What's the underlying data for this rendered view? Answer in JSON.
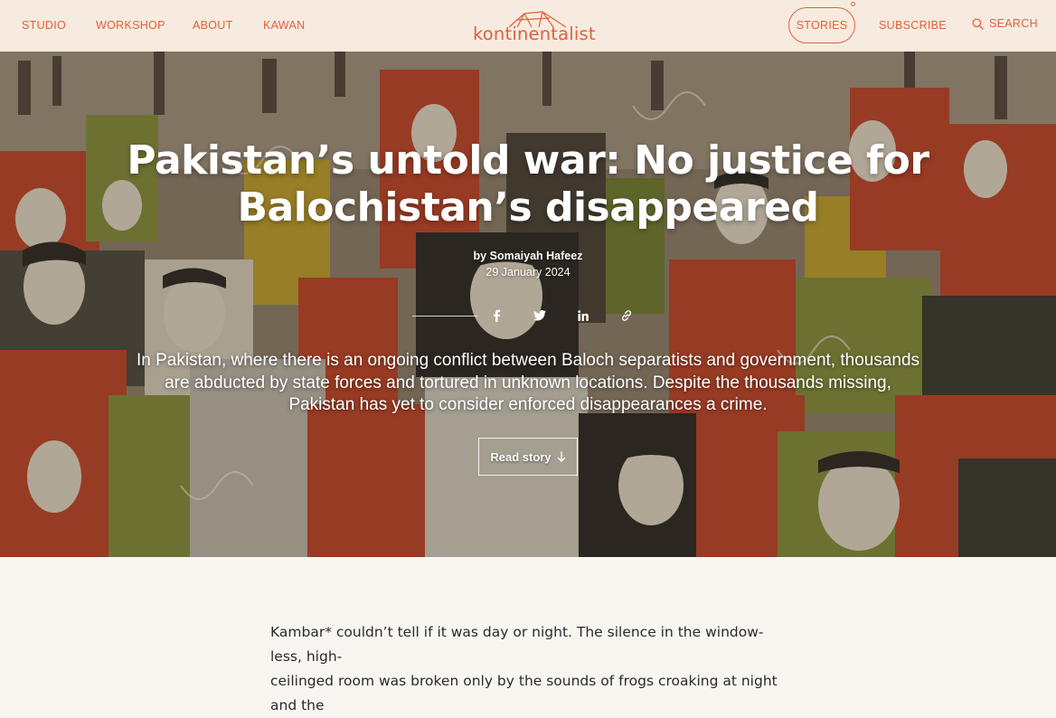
{
  "nav": {
    "left_links": [
      "STUDIO",
      "WORKSHOP",
      "ABOUT",
      "KAWAN"
    ],
    "logo_text": "kontinentalist",
    "stories_label": "STORIES",
    "subscribe_label": "SUBSCRIBE",
    "search_label": "SEARCH",
    "search_icon": "search-icon"
  },
  "hero": {
    "title_line1": "Pakistan’s untold war: No justice for",
    "title_line2": "Balochistan’s disappeared",
    "byline": "by Somaiyah Hafeez",
    "date": "29 January 2024",
    "share_icons": [
      "facebook-icon",
      "twitter-icon",
      "linkedin-icon",
      "link-icon"
    ],
    "dek": "In Pakistan, where there is an ongoing conflict between Baloch separatists and government, thousands are abducted by state forces and tortured in unknown locations. Despite the thousands missing, Pakistan has yet to consider enforced disappearances a crime.",
    "read_story_label": "Read story",
    "read_story_icon": "arrow-down-icon"
  },
  "article": {
    "line1": "Kambar* couldn’t tell if it was day or night. The silence in the window-less, high-",
    "line2": "ceilinged room was broken only by the sounds of frogs croaking at night and the"
  },
  "colors": {
    "accent": "#e0603e",
    "nav_bg": "#f7ebdf",
    "page_bg": "#f9f6f2",
    "illustration_red": "#b8442a",
    "illustration_olive": "#7f8a3a",
    "illustration_mustard": "#b79a2e",
    "illustration_dark": "#2c2a24"
  }
}
